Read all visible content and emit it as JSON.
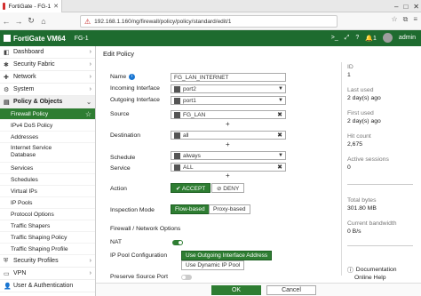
{
  "browser": {
    "tab_title": "FortiGate - FG-1",
    "url": "192.168.1.160/ng/firewall/policy/policy/standard/edit/1",
    "url_warning": "⚠"
  },
  "header": {
    "product": "FortiGate VM64",
    "hostname": "FG-1",
    "user": "admin",
    "alert_count": "1"
  },
  "sidebar": {
    "items": [
      {
        "label": "Dashboard"
      },
      {
        "label": "Security Fabric"
      },
      {
        "label": "Network"
      },
      {
        "label": "System"
      },
      {
        "label": "Policy & Objects"
      }
    ],
    "subitems": [
      {
        "label": "Firewall Policy"
      },
      {
        "label": "IPv4 DoS Policy"
      },
      {
        "label": "Addresses"
      },
      {
        "label": "Internet Service\nDatabase"
      },
      {
        "label": "Services"
      },
      {
        "label": "Schedules"
      },
      {
        "label": "Virtual IPs"
      },
      {
        "label": "IP Pools"
      },
      {
        "label": "Protocol Options"
      },
      {
        "label": "Traffic Shapers"
      },
      {
        "label": "Traffic Shaping Policy"
      },
      {
        "label": "Traffic Shaping Profile"
      }
    ],
    "bottom_items": [
      {
        "label": "Security Profiles"
      },
      {
        "label": "VPN"
      },
      {
        "label": "User & Authentication"
      }
    ]
  },
  "form": {
    "title": "Edit Policy",
    "name_label": "Name",
    "name_value": "FG_LAN_INTERNET",
    "incoming_label": "Incoming Interface",
    "incoming_value": "port2",
    "outgoing_label": "Outgoing Interface",
    "outgoing_value": "port1",
    "source_label": "Source",
    "source_value": "FG_LAN",
    "destination_label": "Destination",
    "destination_value": "all",
    "schedule_label": "Schedule",
    "schedule_value": "always",
    "service_label": "Service",
    "service_value": "ALL",
    "action_label": "Action",
    "accept_label": "✔ ACCEPT",
    "deny_label": "⊘ DENY",
    "inspection_label": "Inspection Mode",
    "flow_label": "Flow-based",
    "proxy_label": "Proxy-based",
    "section_label": "Firewall / Network Options",
    "nat_label": "NAT",
    "ippool_label": "IP Pool Configuration",
    "ippool_opt1": "Use Outgoing Interface Address",
    "ippool_opt2": "Use Dynamic IP Pool",
    "preserve_label": "Preserve Source Port",
    "ok_label": "OK",
    "cancel_label": "Cancel"
  },
  "info": {
    "id_label": "ID",
    "id_value": "1",
    "last_used_label": "Last used",
    "last_used_value": "2 day(s) ago",
    "first_used_label": "First used",
    "first_used_value": "2 day(s) ago",
    "hit_count_label": "Hit count",
    "hit_count_value": "2,675",
    "active_sessions_label": "Active sessions",
    "active_sessions_value": "0",
    "total_bytes_label": "Total bytes",
    "total_bytes_value": "301.80 MB",
    "bandwidth_label": "Current bandwidth",
    "bandwidth_value": "0 B/s",
    "doc_label": "Documentation",
    "online_help_label": "Online Help"
  }
}
